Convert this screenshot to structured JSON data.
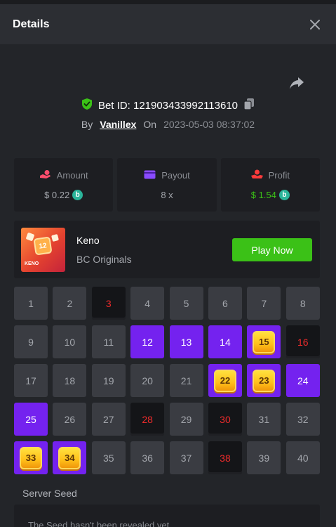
{
  "header": {
    "title": "Details"
  },
  "bet": {
    "id_label": "Bet ID: 121903433992113610",
    "by_label": "By",
    "user": "Vanillex",
    "on_label": "On",
    "date": "2023-05-03 08:37:02"
  },
  "stats": [
    {
      "label": "Amount",
      "value": "$ 0.22",
      "icon": "amount-icon",
      "color": "#ff4d6d"
    },
    {
      "label": "Payout",
      "value": "8 x",
      "icon": "payout-card-icon",
      "color": "#8a4bff"
    },
    {
      "label": "Profit",
      "value": "$ 1.54",
      "icon": "profit-icon",
      "color": "#ff3b3b"
    }
  ],
  "coin": {
    "glyph": "b",
    "color": "#2bb49a"
  },
  "game": {
    "name": "Keno",
    "provider": "BC Originals",
    "play_label": "Play Now",
    "thumb_number": "12",
    "thumb_label": "KENO"
  },
  "board": {
    "cells": [
      {
        "n": "1",
        "s": "plain"
      },
      {
        "n": "2",
        "s": "plain"
      },
      {
        "n": "3",
        "s": "drawn"
      },
      {
        "n": "4",
        "s": "plain"
      },
      {
        "n": "5",
        "s": "plain"
      },
      {
        "n": "6",
        "s": "plain"
      },
      {
        "n": "7",
        "s": "plain"
      },
      {
        "n": "8",
        "s": "plain"
      },
      {
        "n": "9",
        "s": "plain"
      },
      {
        "n": "10",
        "s": "plain"
      },
      {
        "n": "11",
        "s": "plain"
      },
      {
        "n": "12",
        "s": "picked"
      },
      {
        "n": "13",
        "s": "picked"
      },
      {
        "n": "14",
        "s": "picked"
      },
      {
        "n": "15",
        "s": "hit"
      },
      {
        "n": "16",
        "s": "drawn"
      },
      {
        "n": "17",
        "s": "plain"
      },
      {
        "n": "18",
        "s": "plain"
      },
      {
        "n": "19",
        "s": "plain"
      },
      {
        "n": "20",
        "s": "plain"
      },
      {
        "n": "21",
        "s": "plain"
      },
      {
        "n": "22",
        "s": "hit"
      },
      {
        "n": "23",
        "s": "hit"
      },
      {
        "n": "24",
        "s": "picked"
      },
      {
        "n": "25",
        "s": "picked"
      },
      {
        "n": "26",
        "s": "plain"
      },
      {
        "n": "27",
        "s": "plain"
      },
      {
        "n": "28",
        "s": "drawn"
      },
      {
        "n": "29",
        "s": "plain"
      },
      {
        "n": "30",
        "s": "drawn"
      },
      {
        "n": "31",
        "s": "plain"
      },
      {
        "n": "32",
        "s": "plain"
      },
      {
        "n": "33",
        "s": "hit"
      },
      {
        "n": "34",
        "s": "hit"
      },
      {
        "n": "35",
        "s": "plain"
      },
      {
        "n": "36",
        "s": "plain"
      },
      {
        "n": "37",
        "s": "plain"
      },
      {
        "n": "38",
        "s": "drawn"
      },
      {
        "n": "39",
        "s": "plain"
      },
      {
        "n": "40",
        "s": "plain"
      }
    ]
  },
  "seed": {
    "label": "Server Seed",
    "text": "The Seed hasn't been revealed yet"
  },
  "colors": {
    "accent_purple": "#7422ef",
    "play_green": "#3bc117",
    "drawn_red": "#ec2b2b",
    "verified_green": "#3bc117"
  }
}
